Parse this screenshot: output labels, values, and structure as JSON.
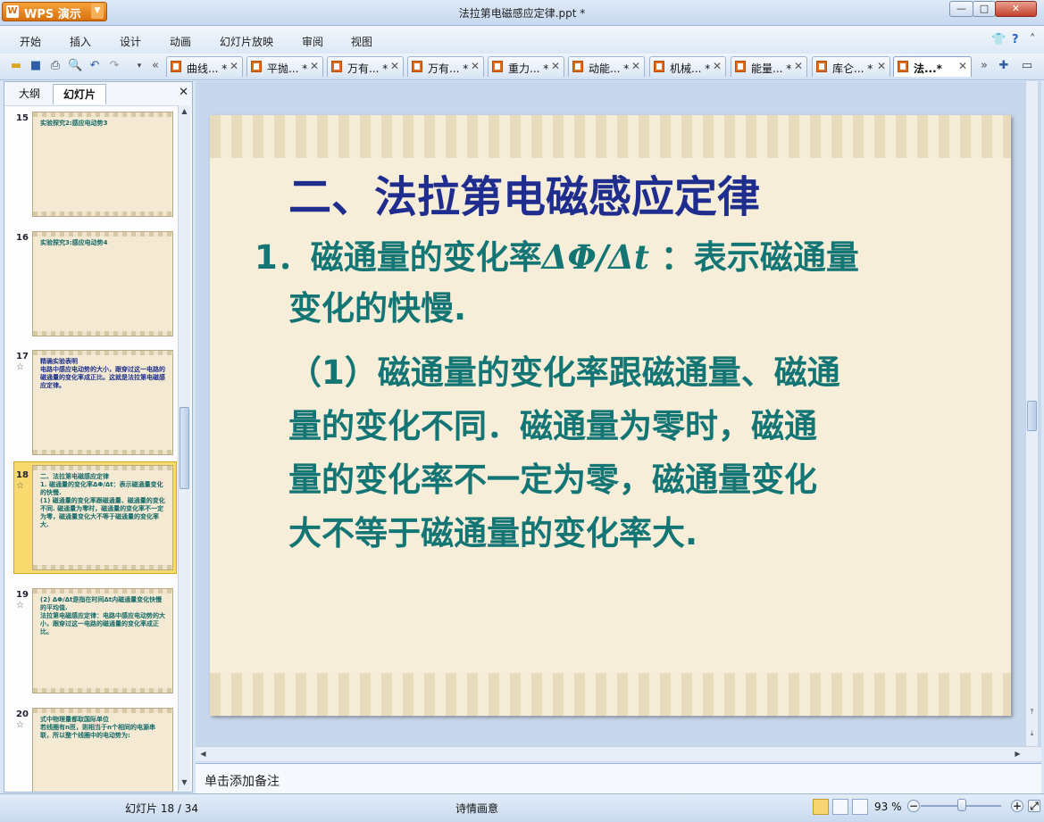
{
  "app": {
    "name": "WPS 演示",
    "logo": "W"
  },
  "window": {
    "title": "法拉第电磁感应定律.ppt *"
  },
  "menu": [
    "开始",
    "插入",
    "设计",
    "动画",
    "幻灯片放映",
    "审阅",
    "视图"
  ],
  "tabs": [
    {
      "label": "曲线...",
      "star": "*"
    },
    {
      "label": "平抛...",
      "star": "*"
    },
    {
      "label": "万有...",
      "star": "*"
    },
    {
      "label": "万有...",
      "star": "*"
    },
    {
      "label": "重力...",
      "star": "*"
    },
    {
      "label": "动能...",
      "star": "*"
    },
    {
      "label": "机械...",
      "star": "*"
    },
    {
      "label": "能量...",
      "star": "*"
    },
    {
      "label": "库仑...",
      "star": "*"
    },
    {
      "label": "法...*",
      "star": ""
    }
  ],
  "sidebar": {
    "tabs": [
      "大纲",
      "幻灯片"
    ],
    "thumbs": [
      {
        "num": "15",
        "text": "实验探究2:感应电动势3"
      },
      {
        "num": "16",
        "text": "实验探究3:感应电动势4"
      },
      {
        "num": "17",
        "text": "精确实验表明\n电路中感应电动势的大小，跟穿过这一电路的磁通量的变化率成正比。这就是法拉第电磁感应定律。"
      },
      {
        "num": "18",
        "text": "二、法拉第电磁感应定律\n1. 磁通量的变化率ΔΦ/Δt：表示磁通量变化的快慢.\n(1) 磁通量的变化率跟磁通量、磁通量的变化不同. 磁通量为零时，磁通量的变化率不一定为零，磁通量变化大不等于磁通量的变化率大."
      },
      {
        "num": "19",
        "text": "(2) ΔΦ/Δt是指在时间Δt内磁通量变化快慢的平均值.\n法拉第电磁感应定律：电路中感应电动势的大小，跟穿过这一电路的磁通量的变化率成正比。"
      },
      {
        "num": "20",
        "text": "式中物理量都取国际单位\n若线圈有n匝，则相当于n个相同的电源串联，所以整个线圈中的电动势为:"
      }
    ]
  },
  "slide": {
    "title": "二、法拉第电磁感应定律",
    "point1_prefix": "1．磁通量的变化率",
    "point1_formula": "ΔΦ/Δt",
    "point1_suffix": " ：表示磁通量",
    "point1_line2": "变化的快慢.",
    "para_lines": [
      "（1）磁通量的变化率跟磁通量、磁通",
      "量的变化不同．磁通量为零时，磁通",
      "量的变化率不一定为零，磁通量变化",
      "大不等于磁通量的变化率大."
    ]
  },
  "notes_placeholder": "单击添加备注",
  "status": {
    "slide_count": "幻灯片 18 / 34",
    "theme": "诗情画意",
    "zoom": "93 %"
  }
}
